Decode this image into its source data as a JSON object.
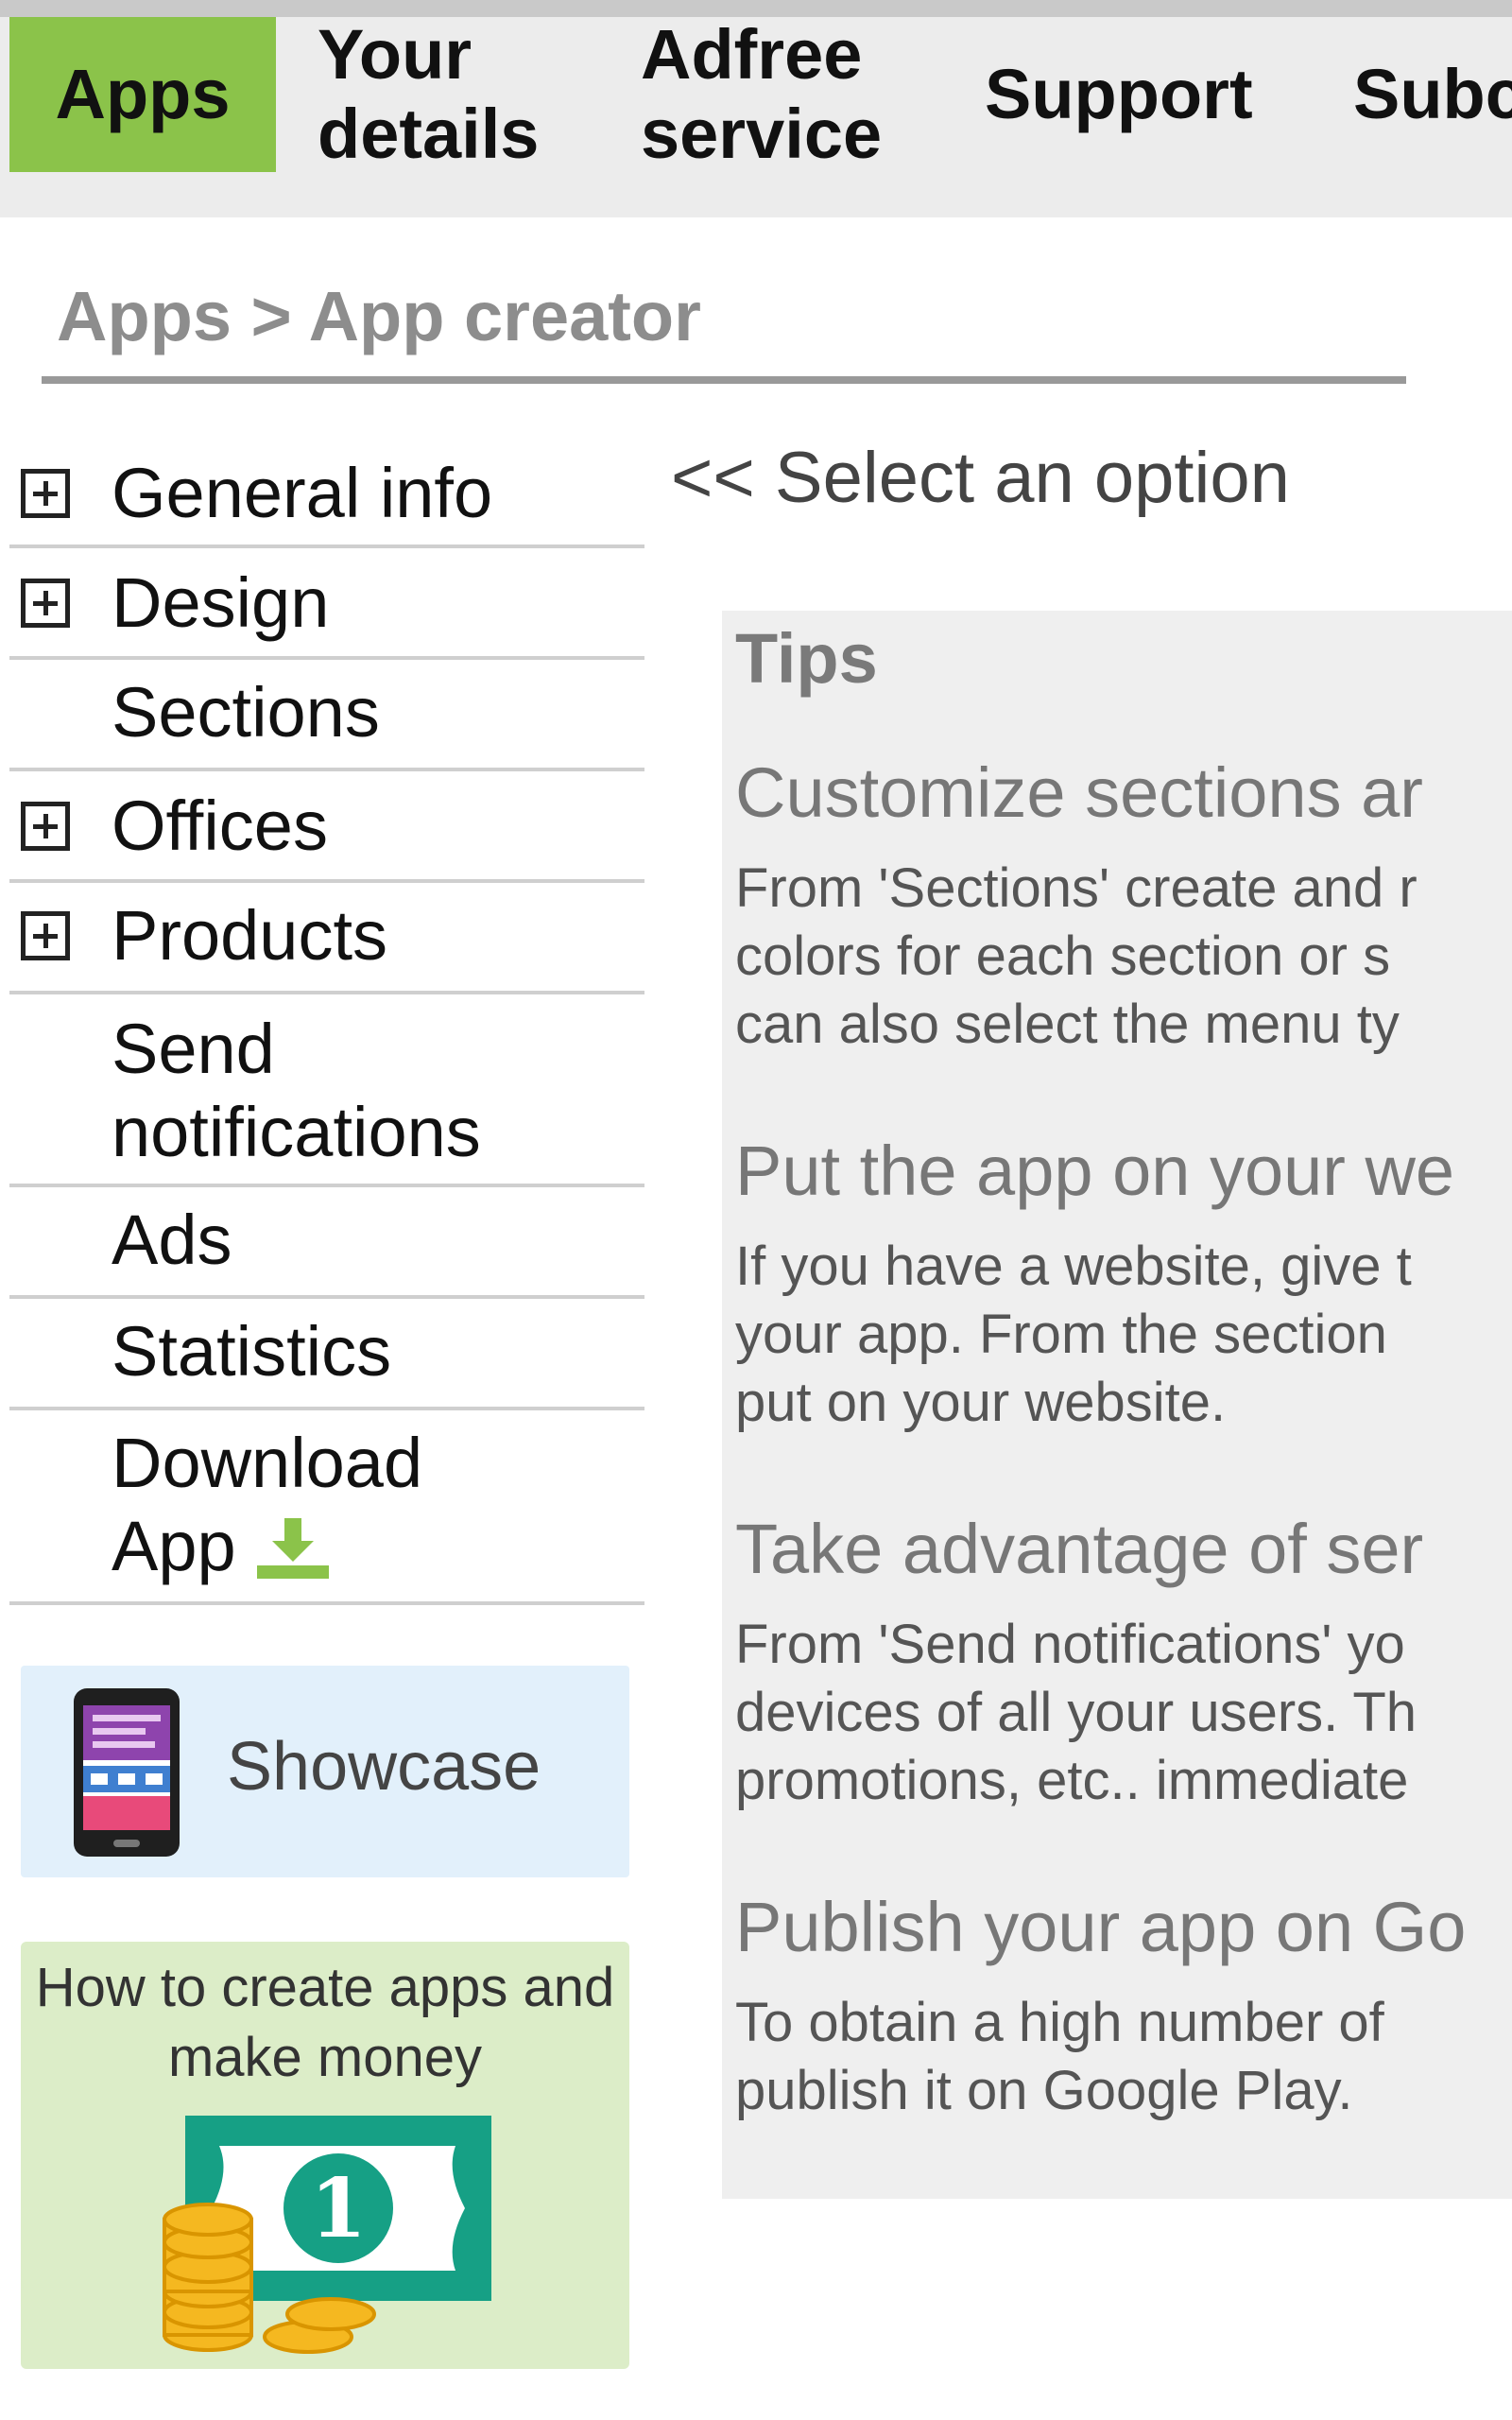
{
  "nav": {
    "items": [
      {
        "label": "Apps"
      },
      {
        "label": "Your details"
      },
      {
        "label": "Adfree service"
      },
      {
        "label": "Support"
      },
      {
        "label": "Subc"
      }
    ]
  },
  "breadcrumb": {
    "text": "Apps > App creator"
  },
  "menu": {
    "items": [
      {
        "label": "General info"
      },
      {
        "label": "Design"
      },
      {
        "label": "Sections"
      },
      {
        "label": "Offices"
      },
      {
        "label": "Products"
      },
      {
        "label": "Send notifications"
      },
      {
        "label": "Ads"
      },
      {
        "label": "Statistics"
      },
      {
        "label": "Download App"
      }
    ]
  },
  "main": {
    "select_option": "<< Select an option"
  },
  "tips": {
    "title": "Tips",
    "items": [
      {
        "heading": "Customize sections ar",
        "lines": [
          "From 'Sections' create and r",
          "colors for each section or s",
          "can also select the menu ty"
        ]
      },
      {
        "heading": "Put the app on your we",
        "lines": [
          "If you have a website, give t",
          "your app. From the section",
          "put on your website."
        ]
      },
      {
        "heading": "Take advantage of ser",
        "lines": [
          "From 'Send notifications' yo",
          "devices of all your users. Th",
          "promotions, etc.. immediate"
        ]
      },
      {
        "heading": "Publish your app on Go",
        "lines": [
          "To obtain a high number of",
          "publish it on Google Play."
        ]
      }
    ]
  },
  "banners": {
    "showcase": "Showcase",
    "howto": "How to create apps and make money",
    "note_value": "1"
  },
  "colors": {
    "accent": "#8bc34a",
    "nav_bg": "#ececec",
    "showcase_bg": "#e2f0fb",
    "howto_bg": "#dcedc8",
    "tips_bg": "#efefef"
  }
}
